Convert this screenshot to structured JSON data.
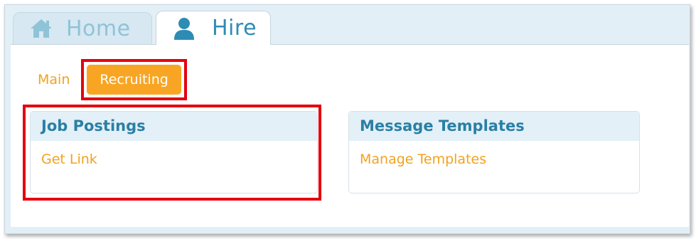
{
  "tabs": {
    "home": {
      "label": "Home",
      "icon": "home-icon"
    },
    "hire": {
      "label": "Hire",
      "icon": "user-icon"
    }
  },
  "subtabs": {
    "main": "Main",
    "recruiting": "Recruiting"
  },
  "panels": {
    "job_postings": {
      "title": "Job Postings",
      "link": "Get Link"
    },
    "message_templates": {
      "title": "Message Templates",
      "link": "Manage Templates"
    }
  },
  "colors": {
    "accent_orange": "#f8a524",
    "link_orange": "#f2a21f",
    "header_blue": "#2a7fa5",
    "highlight_red": "#e4000f"
  }
}
